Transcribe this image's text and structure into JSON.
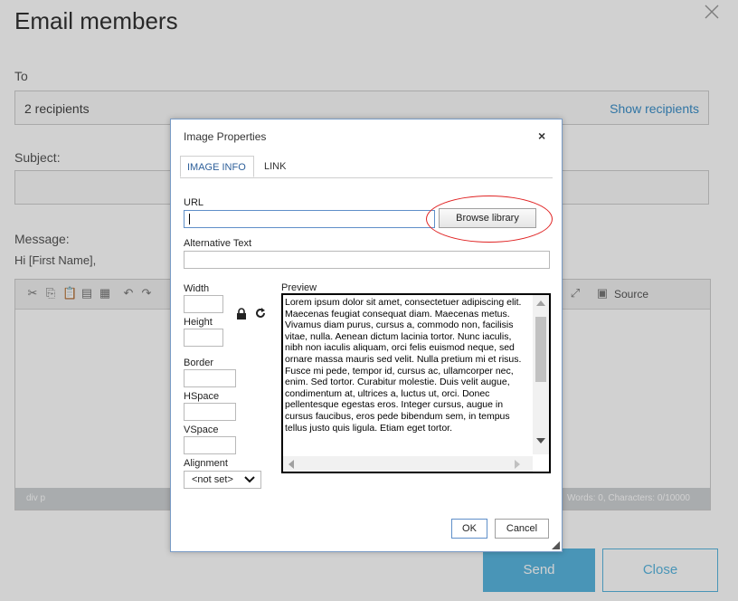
{
  "page": {
    "title": "Email members",
    "to_label": "To",
    "recipients_text": "2 recipients",
    "show_recipients": "Show recipients",
    "subject_label": "Subject:",
    "message_label": "Message:",
    "greeting": "Hi [First Name],",
    "source_label": "Source",
    "status_path": "div  p",
    "status_count": "Words: 0, Characters: 0/10000",
    "send_label": "Send",
    "close_label": "Close"
  },
  "dialog": {
    "title": "Image Properties",
    "close_glyph": "×",
    "tabs": [
      {
        "label": "IMAGE INFO",
        "active": true
      },
      {
        "label": "LINK",
        "active": false
      }
    ],
    "url_label": "URL",
    "url_value": "",
    "browse_label": "Browse library",
    "alt_label": "Alternative Text",
    "alt_value": "",
    "width_label": "Width",
    "height_label": "Height",
    "border_label": "Border",
    "hspace_label": "HSpace",
    "vspace_label": "VSpace",
    "alignment_label": "Alignment",
    "alignment_value": "<not set>",
    "preview_label": "Preview",
    "preview_text": "Lorem ipsum dolor sit amet, consectetuer adipiscing elit. Maecenas feugiat consequat diam. Maecenas metus. Vivamus diam purus, cursus a, commodo non, facilisis vitae, nulla. Aenean dictum lacinia tortor. Nunc iaculis, nibh non iaculis aliquam, orci felis euismod neque, sed ornare massa mauris sed velit. Nulla pretium mi et risus. Fusce mi pede, tempor id, cursus ac, ullamcorper nec, enim. Sed tortor. Curabitur molestie. Duis velit augue, condimentum at, ultrices a, luctus ut, orci. Donec pellentesque egestas eros. Integer cursus, augue in cursus faucibus, eros pede bibendum sem, in tempus tellus justo quis ligula. Etiam eget tortor.",
    "ok_label": "OK",
    "cancel_label": "Cancel"
  },
  "colors": {
    "accent": "#5ab6e0",
    "link": "#3b8fc9",
    "highlight": "#e02424",
    "dialog_border": "#7a9cc6"
  }
}
